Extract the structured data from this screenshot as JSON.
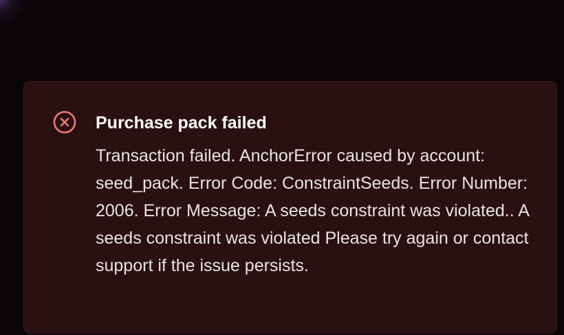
{
  "toast": {
    "type": "error",
    "icon": "error-circle-x-icon",
    "title": "Purchase pack failed",
    "message": "Transaction failed. AnchorError caused by account: seed_pack. Error Code: ConstraintSeeds. Error Number: 2006. Error Message: A seeds constraint was violated.. A seeds constraint was violated Please try again or contact support if the issue persists.",
    "colors": {
      "background": "#2a1011",
      "accent": "#f07a72",
      "title": "#ffffff",
      "text": "#e9e3e3"
    }
  }
}
